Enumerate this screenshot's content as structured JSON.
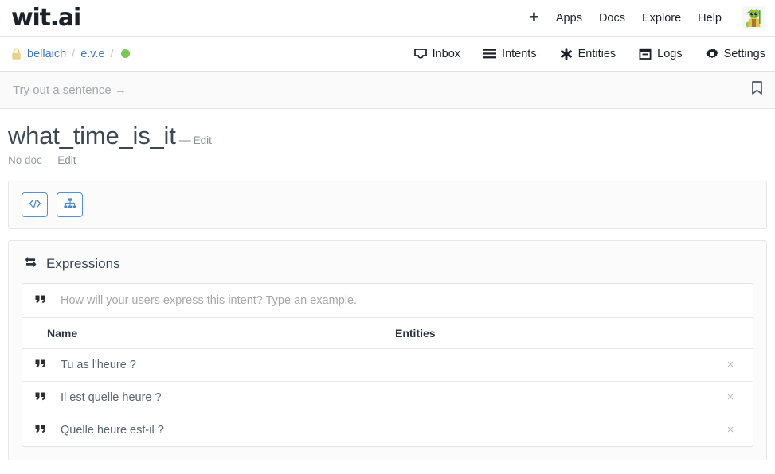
{
  "header": {
    "logo": "wit.ai",
    "plus_icon": "plus-icon",
    "nav": [
      {
        "label": "Apps",
        "name": "apps"
      },
      {
        "label": "Docs",
        "name": "docs"
      },
      {
        "label": "Explore",
        "name": "explore"
      },
      {
        "label": "Help",
        "name": "help"
      }
    ],
    "avatar_alt": "yoda-avatar"
  },
  "subheader": {
    "lock_icon": "lock-icon",
    "breadcrumb": [
      {
        "label": "bellaich",
        "name": "breadcrumb-user"
      },
      {
        "label": "e.v.e",
        "name": "breadcrumb-app"
      }
    ],
    "separator": "/",
    "status_color": "#7dc653",
    "nav": [
      {
        "label": "Inbox",
        "icon": "inbox-icon"
      },
      {
        "label": "Intents",
        "icon": "list-icon"
      },
      {
        "label": "Entities",
        "icon": "asterisk-icon"
      },
      {
        "label": "Logs",
        "icon": "archive-icon"
      },
      {
        "label": "Settings",
        "icon": "gear-icon"
      }
    ]
  },
  "trybar": {
    "placeholder": "Try out a sentence →",
    "bookmark_icon": "bookmark-icon"
  },
  "intent": {
    "title": "what_time_is_it",
    "title_dash": "—",
    "title_edit": "Edit",
    "doc_text": "No doc",
    "doc_dash": "—",
    "doc_edit": "Edit"
  },
  "tools": {
    "code_button": "code-icon",
    "tree_button": "sitemap-icon"
  },
  "expressions": {
    "section_icon": "exchange-arrows-icon",
    "section_title": "Expressions",
    "input_placeholder": "How will your users express this intent? Type an example.",
    "columns": [
      {
        "label": "Name",
        "name": "column-name"
      },
      {
        "label": "Entities",
        "name": "column-entities"
      }
    ],
    "rows": [
      {
        "name": "Tu as l'heure ?",
        "entities": "",
        "delete_label": "×"
      },
      {
        "name": "Il est quelle heure ?",
        "entities": "",
        "delete_label": "×"
      },
      {
        "name": "Quelle heure est-il ?",
        "entities": "",
        "delete_label": "×"
      }
    ]
  },
  "colors": {
    "link": "#3b78c3",
    "accent_button_border": "#5591d0",
    "status_green": "#7dc653",
    "text_primary": "#1d2129",
    "text_muted": "#9aa0a7"
  }
}
